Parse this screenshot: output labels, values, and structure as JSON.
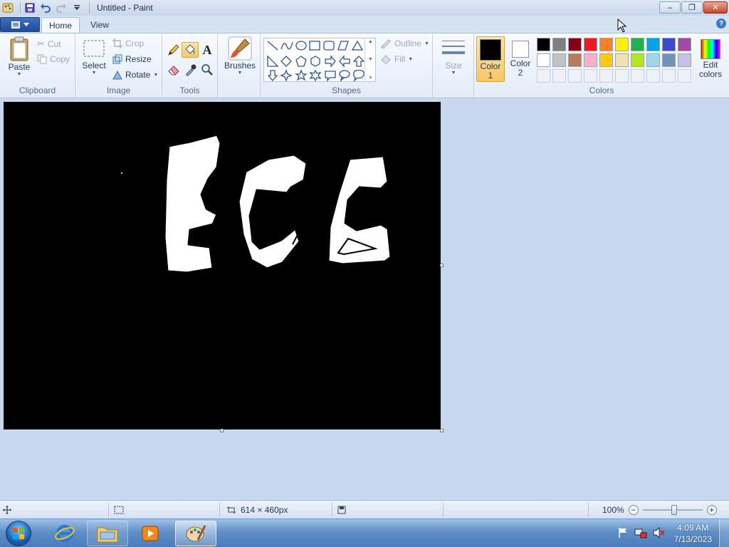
{
  "window": {
    "title": "Untitled - Paint"
  },
  "tabs": {
    "file_icon": "menu-icon",
    "home": "Home",
    "view": "View"
  },
  "ribbon": {
    "clipboard": {
      "label": "Clipboard",
      "paste": "Paste",
      "cut": "Cut",
      "copy": "Copy"
    },
    "image": {
      "label": "Image",
      "select": "Select",
      "crop": "Crop",
      "resize": "Resize",
      "rotate": "Rotate"
    },
    "tools": {
      "label": "Tools",
      "text_tool_glyph": "A"
    },
    "brushes": {
      "label": "Brushes"
    },
    "shapes": {
      "label": "Shapes",
      "outline": "Outline",
      "fill": "Fill"
    },
    "size": {
      "label": "Size"
    },
    "colors": {
      "label": "Colors",
      "color1": "Color 1",
      "color1_lines": [
        "Color",
        "1"
      ],
      "color1_value": "#000000",
      "color2_lines": [
        "Color",
        "2"
      ],
      "color2_value": "#ffffff",
      "edit_lines": [
        "Edit",
        "colors"
      ],
      "palette_row1": [
        "#000000",
        "#7f7f7f",
        "#880015",
        "#ed1c24",
        "#ff7f27",
        "#fff200",
        "#22b14c",
        "#00a2e8",
        "#3f48cc",
        "#a349a4"
      ],
      "palette_row2": [
        "#ffffff",
        "#c3c3c3",
        "#b97a57",
        "#ffaec9",
        "#ffc90e",
        "#efe4b0",
        "#b5e61d",
        "#99d9ea",
        "#7092be",
        "#c8bfe7"
      ]
    }
  },
  "canvas": {
    "background": "#000000",
    "drawing_text": "ECG"
  },
  "status": {
    "canvas_size": "614 × 460px",
    "zoom": "100%"
  },
  "taskbar": {
    "time": "4:09 AM",
    "date": "7/13/2023"
  }
}
